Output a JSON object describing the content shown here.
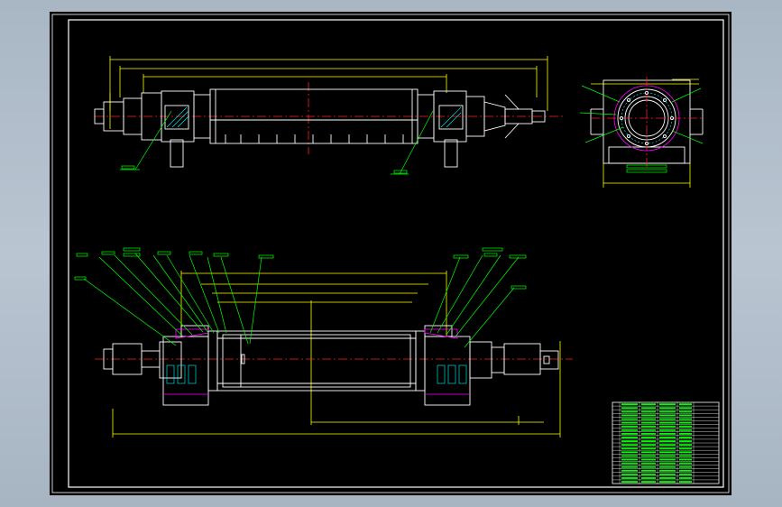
{
  "app": {
    "viewport_background": "#000000",
    "chrome_background": "#b0bcca"
  },
  "colors": {
    "frame": "#ffffff",
    "dimension": "#ffff00",
    "part_outline": "#ffffff",
    "centerline": "#ff2020",
    "leader": "#00ff00",
    "hatch": "#00ffff",
    "seal": "#ff00ff"
  },
  "drawing": {
    "views": [
      {
        "id": "top-view",
        "label": ""
      },
      {
        "id": "end-view",
        "label": ""
      },
      {
        "id": "section-view",
        "label": ""
      }
    ],
    "title_block": {
      "rows": 22,
      "columns": 6
    }
  }
}
